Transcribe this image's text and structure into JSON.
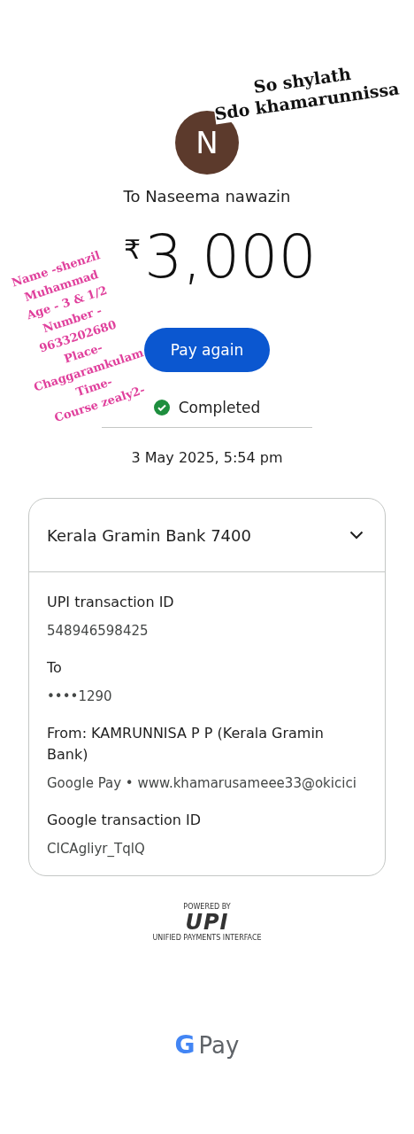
{
  "recipient": {
    "initial": "N",
    "label": "To Naseema nawazin"
  },
  "amount": {
    "currency": "₹",
    "value": "3,000"
  },
  "pay_again_button": "Pay again",
  "status": {
    "label": "Completed",
    "completed": true
  },
  "date": "3 May 2025, 5:54 pm",
  "details_card": {
    "bank": "Kerala Gramin Bank 7400",
    "expanded": true,
    "fields": [
      {
        "label": "UPI transaction ID",
        "value": "548946598425"
      },
      {
        "label": "To",
        "value": "••••1290"
      },
      {
        "label": "From: KAMRUNNISA P P (Kerala Gramin Bank)",
        "value": "Google Pay • www.khamarusameee33@okicici"
      },
      {
        "label": "Google transaction ID",
        "value": "CICAgliyr_TqlQ"
      }
    ]
  },
  "footer": {
    "powered_by": "POWERED BY",
    "upi_logo": "UPI",
    "upi_subtitle": "UNIFIED PAYMENTS INTERFACE",
    "gpay_letter": "G",
    "gpay_label": "Pay"
  },
  "annotations": [
    {
      "kind": "right",
      "color": "#111111",
      "lines": [
        "So shylath",
        "Sdo khamarunnissa"
      ]
    },
    {
      "kind": "left",
      "color": "#e0409c",
      "lines": [
        "Name -shenzil",
        "Muhammad",
        "Age - 3 & 1/2",
        "Number -",
        "9633202680",
        "Place-",
        "Chaggaramkulam",
        "Time-",
        "Course zealy2-"
      ]
    }
  ]
}
